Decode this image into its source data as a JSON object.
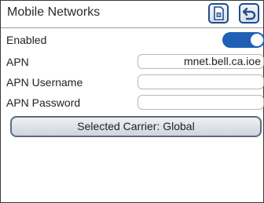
{
  "header": {
    "title": "Mobile Networks",
    "sim_button_icon": "sim-card-icon",
    "back_button_icon": "back-arrow-icon"
  },
  "colors": {
    "accent": "#1f5fb5",
    "header_button_border": "#1f4e8c"
  },
  "settings": {
    "enabled_label": "Enabled",
    "enabled_value": true,
    "apn_label": "APN",
    "apn_value": "mnet.bell.ca.ioe",
    "apn_username_label": "APN Username",
    "apn_username_value": "",
    "apn_password_label": "APN Password",
    "apn_password_value": ""
  },
  "carrier_button": {
    "label": "Selected Carrier: Global"
  }
}
